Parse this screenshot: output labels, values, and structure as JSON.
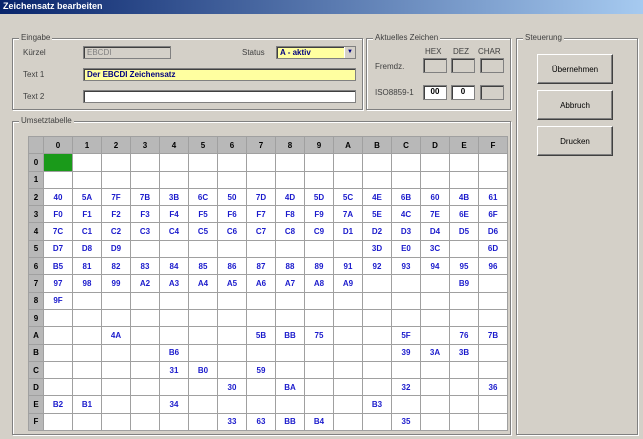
{
  "window": {
    "title": "Zeichensatz bearbeiten"
  },
  "eingabe": {
    "legend": "Eingabe",
    "kuerzel_label": "Kürzel",
    "kuerzel_value": "EBCDI",
    "status_label": "Status",
    "status_value": "A - aktiv",
    "text1_label": "Text 1",
    "text1_value": "Der EBCDI Zeichensatz",
    "text2_label": "Text 2",
    "text2_value": ""
  },
  "aktuelles_zeichen": {
    "legend": "Aktuelles Zeichen",
    "col_hex": "HEX",
    "col_dez": "DEZ",
    "col_char": "CHAR",
    "fremd_label": "Fremdz.",
    "iso_label": "ISO8859-1",
    "iso_hex": "00",
    "iso_dez": "0"
  },
  "steuerung": {
    "legend": "Steuerung",
    "uebernehmen_label": "Übernehmen",
    "abbruch_label": "Abbruch",
    "drucken_label": "Drucken"
  },
  "umsetz": {
    "legend": "Umsetztabelle",
    "columns": [
      "0",
      "1",
      "2",
      "3",
      "4",
      "5",
      "6",
      "7",
      "8",
      "9",
      "A",
      "B",
      "C",
      "D",
      "E",
      "F"
    ],
    "rows": [
      {
        "h": "0",
        "c": [
          "",
          "",
          "",
          "",
          "",
          "",
          "",
          "",
          "",
          "",
          "",
          "",
          "",
          "",
          "",
          ""
        ]
      },
      {
        "h": "1",
        "c": [
          "",
          "",
          "",
          "",
          "",
          "",
          "",
          "",
          "",
          "",
          "",
          "",
          "",
          "",
          "",
          ""
        ]
      },
      {
        "h": "2",
        "c": [
          "40",
          "5A",
          "7F",
          "7B",
          "3B",
          "6C",
          "50",
          "7D",
          "4D",
          "5D",
          "5C",
          "4E",
          "6B",
          "60",
          "4B",
          "61"
        ]
      },
      {
        "h": "3",
        "c": [
          "F0",
          "F1",
          "F2",
          "F3",
          "F4",
          "F5",
          "F6",
          "F7",
          "F8",
          "F9",
          "7A",
          "5E",
          "4C",
          "7E",
          "6E",
          "6F"
        ]
      },
      {
        "h": "4",
        "c": [
          "7C",
          "C1",
          "C2",
          "C3",
          "C4",
          "C5",
          "C6",
          "C7",
          "C8",
          "C9",
          "D1",
          "D2",
          "D3",
          "D4",
          "D5",
          "D6"
        ]
      },
      {
        "h": "5",
        "c": [
          "D7",
          "D8",
          "D9",
          "",
          "",
          "",
          "",
          "",
          "",
          "",
          "",
          "3D",
          "E0",
          "3C",
          "",
          "6D"
        ]
      },
      {
        "h": "6",
        "c": [
          "B5",
          "81",
          "82",
          "83",
          "84",
          "85",
          "86",
          "87",
          "88",
          "89",
          "91",
          "92",
          "93",
          "94",
          "95",
          "96"
        ]
      },
      {
        "h": "7",
        "c": [
          "97",
          "98",
          "99",
          "A2",
          "A3",
          "A4",
          "A5",
          "A6",
          "A7",
          "A8",
          "A9",
          "",
          "",
          "",
          "B9",
          ""
        ]
      },
      {
        "h": "8",
        "c": [
          "9F",
          "",
          "",
          "",
          "",
          "",
          "",
          "",
          "",
          "",
          "",
          "",
          "",
          "",
          "",
          ""
        ]
      },
      {
        "h": "9",
        "c": [
          "",
          "",
          "",
          "",
          "",
          "",
          "",
          "",
          "",
          "",
          "",
          "",
          "",
          "",
          "",
          ""
        ]
      },
      {
        "h": "A",
        "c": [
          "",
          "",
          "4A",
          "",
          "",
          "",
          "",
          "5B",
          "BB",
          "75",
          "",
          "",
          "5F",
          "",
          "76",
          "7B"
        ]
      },
      {
        "h": "B",
        "c": [
          "",
          "",
          "",
          "",
          "B6",
          "",
          "",
          "",
          "",
          "",
          "",
          "",
          "39",
          "3A",
          "3B",
          ""
        ]
      },
      {
        "h": "C",
        "c": [
          "",
          "",
          "",
          "",
          "31",
          "B0",
          "",
          "59",
          "",
          "",
          "",
          "",
          "",
          "",
          "",
          ""
        ]
      },
      {
        "h": "D",
        "c": [
          "",
          "",
          "",
          "",
          "",
          "",
          "30",
          "",
          "BA",
          "",
          "",
          "",
          "32",
          "",
          "",
          "36"
        ]
      },
      {
        "h": "E",
        "c": [
          "B2",
          "B1",
          "",
          "",
          "34",
          "",
          "",
          "",
          "",
          "",
          "",
          "B3",
          "",
          "",
          "",
          ""
        ]
      },
      {
        "h": "F",
        "c": [
          "",
          "",
          "",
          "",
          "",
          "",
          "33",
          "63",
          "BB",
          "B4",
          "",
          "",
          "35",
          "",
          "",
          ""
        ]
      }
    ]
  }
}
